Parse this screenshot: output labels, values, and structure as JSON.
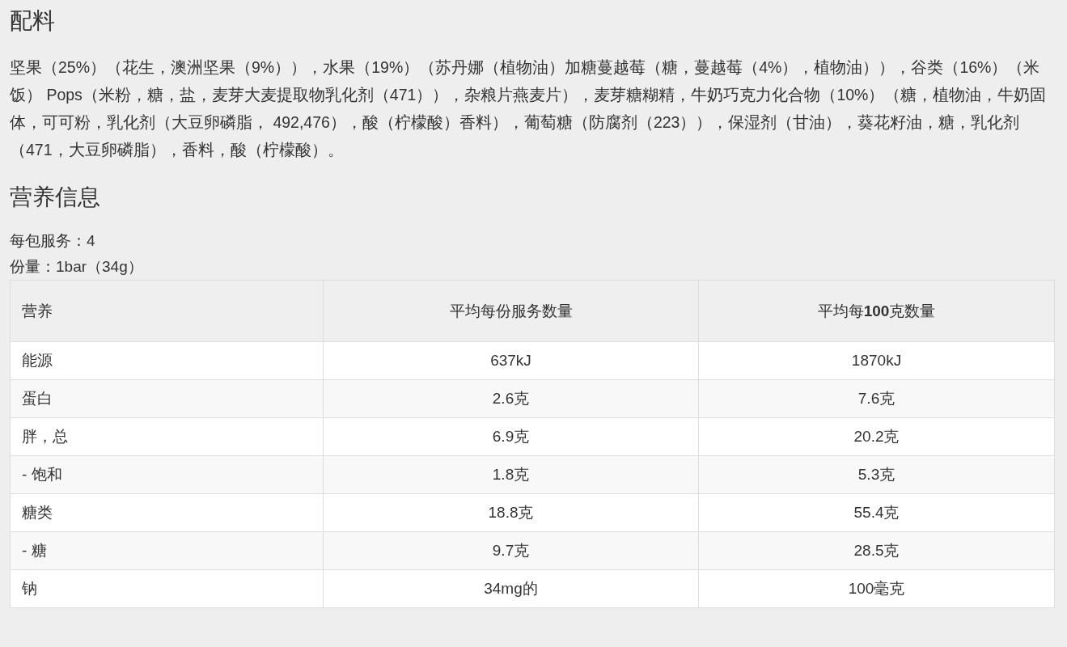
{
  "ingredients": {
    "heading": "配料",
    "text": "坚果（25%）（花生，澳洲坚果（9%）），水果（19%）（苏丹娜（植物油）加糖蔓越莓（糖，蔓越莓（4%），植物油）），谷类（16%）（米饭） Pops（米粉，糖，盐，麦芽大麦提取物乳化剂（471）），杂粮片燕麦片），麦芽糖糊精，牛奶巧克力化合物（10%）（糖，植物油，牛奶固体，可可粉，乳化剂（大豆卵磷脂， 492,476），酸（柠檬酸）香料），葡萄糖（防腐剂（223）），保湿剂（甘油），葵花籽油，糖，乳化剂（471，大豆卵磷脂），香料，酸（柠檬酸）。"
  },
  "nutrition": {
    "heading": "营养信息",
    "servings_per_pack": "每包服务：4",
    "serving_size": "份量：1bar（34g）",
    "table": {
      "columns": [
        "营养",
        "平均每份服务数量",
        "平均每**100**克数量"
      ],
      "rows": [
        [
          "能源",
          "637kJ",
          "1870kJ"
        ],
        [
          "蛋白",
          "2.6克",
          "7.6克"
        ],
        [
          "胖，总",
          "6.9克",
          "20.2克"
        ],
        [
          "- 饱和",
          "1.8克",
          "5.3克"
        ],
        [
          "糖类",
          "18.8克",
          "55.4克"
        ],
        [
          "- 糖",
          "9.7克",
          "28.5克"
        ],
        [
          "钠",
          "34mg的",
          "100毫克"
        ]
      ]
    }
  }
}
